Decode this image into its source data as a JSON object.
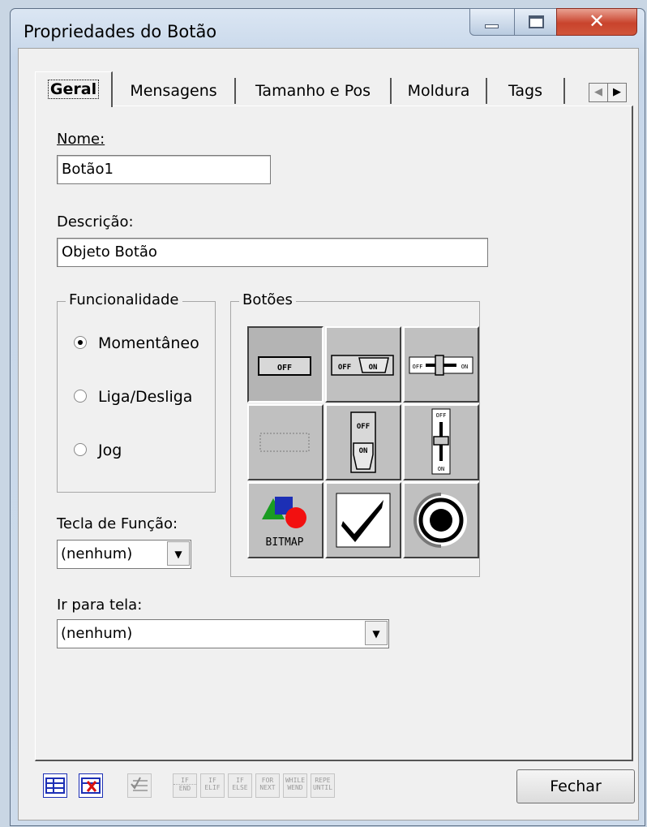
{
  "window": {
    "title": "Propriedades do Botão"
  },
  "tabs": [
    {
      "label": "Geral",
      "selected": true
    },
    {
      "label": "Mensagens"
    },
    {
      "label": "Tamanho e Pos"
    },
    {
      "label": "Moldura"
    },
    {
      "label": "Tags"
    }
  ],
  "general": {
    "name_label": "Nome:",
    "name_value": "Botão1",
    "description_label": "Descrição:",
    "description_value": "Objeto Botão",
    "functionality_label": "Funcionalidade",
    "options": [
      "Momentâneo",
      "Liga/Desliga",
      "Jog"
    ],
    "selected_option": "Momentâneo",
    "buttons_label": "Botões",
    "button_styles": [
      {
        "id": "push-off",
        "text": "OFF"
      },
      {
        "id": "switch-off-on",
        "text": "OFF ON"
      },
      {
        "id": "slider-horizontal",
        "text": "OFF ON"
      },
      {
        "id": "blank",
        "text": ""
      },
      {
        "id": "switch-vertical",
        "text": "OFF ON"
      },
      {
        "id": "slider-vertical",
        "text": "OFF ON"
      },
      {
        "id": "bitmap",
        "text": "BITMAP"
      },
      {
        "id": "checkmark",
        "text": ""
      },
      {
        "id": "radio-target",
        "text": ""
      }
    ],
    "function_key_label": "Tecla de Função:",
    "function_key_value": "(nenhum)",
    "goto_screen_label": "Ir para tela:",
    "goto_screen_value": "(nenhum)"
  },
  "toolbar": {
    "script_keywords": [
      [
        "IF",
        "END"
      ],
      [
        "IF",
        "ELIF"
      ],
      [
        "IF",
        "ELSE"
      ],
      [
        "FOR",
        "NEXT"
      ],
      [
        "WHILE",
        "WEND"
      ],
      [
        "REPE",
        "UNTIL"
      ]
    ]
  },
  "footer": {
    "close_label": "Fechar"
  },
  "colors": {
    "accent_blue": "#1c2fb5",
    "close_red": "#c9432c",
    "bitmap_green": "#1a9c22",
    "bitmap_red": "#f21010"
  }
}
